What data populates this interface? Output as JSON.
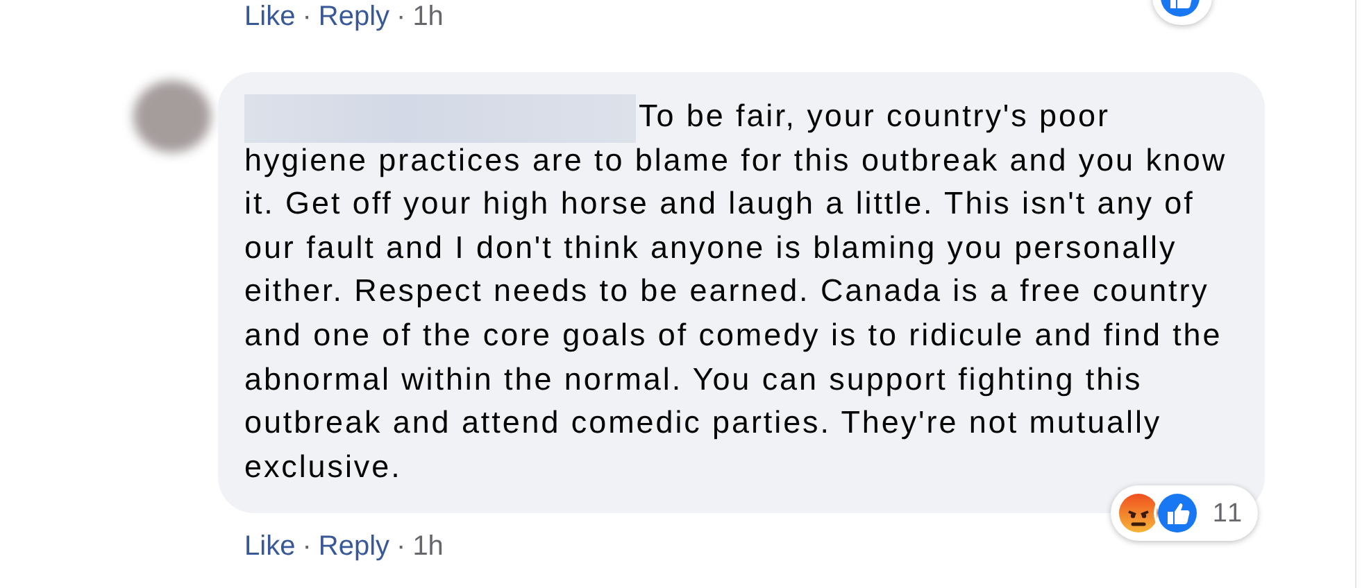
{
  "previous_comment": {
    "actions": [
      {
        "kind": "link",
        "text": "Like"
      },
      {
        "kind": "separator",
        "text": "·"
      },
      {
        "kind": "link",
        "text": "Reply"
      },
      {
        "kind": "separator",
        "text": "·"
      },
      {
        "kind": "time",
        "text": "1h"
      }
    ],
    "reactions": {
      "icons": [
        {
          "kind": "like"
        }
      ]
    }
  },
  "comment": {
    "text": "To be fair, your country's poor hygiene practices are to blame for this outbreak and you know it. Get off your high horse and laugh a little. This isn't any of our fault and I don't think anyone is blaming you personally either. Respect needs to be earned. Canada is a free country and one of the core goals of comedy is to ridicule and find the abnormal within the normal. You can support fighting this outbreak and attend comedic parties. They're not mutually exclusive.",
    "reactions": {
      "icons": [
        {
          "kind": "angry"
        },
        {
          "kind": "like"
        }
      ],
      "count": "11"
    },
    "actions": [
      {
        "kind": "link",
        "text": "Like"
      },
      {
        "kind": "separator",
        "text": "·"
      },
      {
        "kind": "link",
        "text": "Reply"
      },
      {
        "kind": "separator",
        "text": "·"
      },
      {
        "kind": "time",
        "text": "1h"
      }
    ]
  }
}
